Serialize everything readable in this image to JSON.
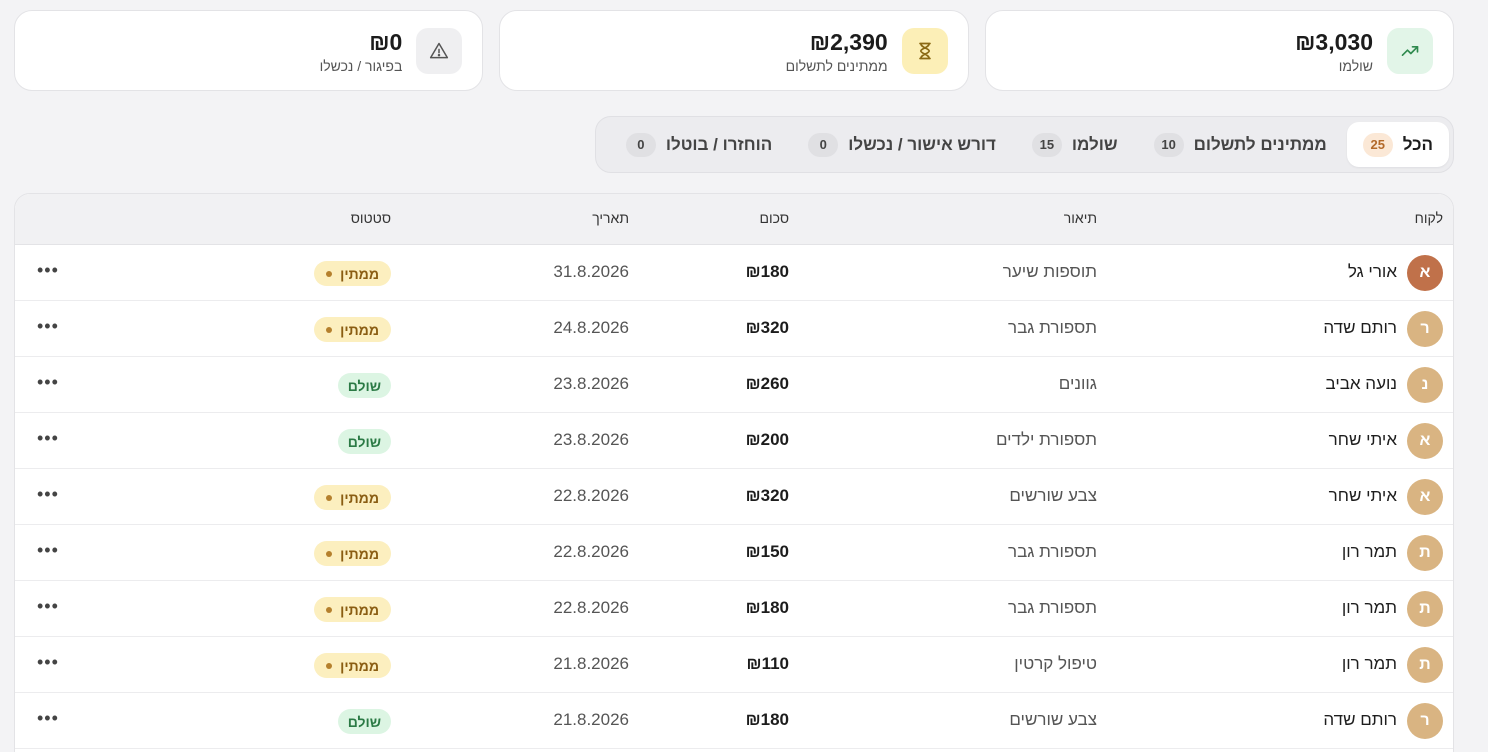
{
  "stats": [
    {
      "amount": "₪3,030",
      "label": "שולמו",
      "icon": "trending-up-icon"
    },
    {
      "amount": "₪2,390",
      "label": "ממתינים לתשלום",
      "icon": "hourglass-icon"
    },
    {
      "amount": "₪0",
      "label": "בפיגור / נכשלו",
      "icon": "warning-icon"
    }
  ],
  "tabs": [
    {
      "label": "הכל",
      "count": "25"
    },
    {
      "label": "ממתינים לתשלום",
      "count": "10"
    },
    {
      "label": "שולמו",
      "count": "15"
    },
    {
      "label": "דורש אישור / נכשלו",
      "count": "0"
    },
    {
      "label": "הוחזרו / בוטלו",
      "count": "0"
    }
  ],
  "table": {
    "headers": {
      "customer": "לקוח",
      "description": "תיאור",
      "amount": "סכום",
      "date": "תאריך",
      "status": "סטטוס"
    },
    "rows": [
      {
        "initial": "א",
        "name": "אורי גל",
        "desc": "תוספות שיער",
        "amount": "₪180",
        "date": "31.8.2026",
        "status": "ממתין"
      },
      {
        "initial": "ר",
        "name": "רותם שדה",
        "desc": "תספורת גבר",
        "amount": "₪320",
        "date": "24.8.2026",
        "status": "ממתין"
      },
      {
        "initial": "נ",
        "name": "נועה אביב",
        "desc": "גוונים",
        "amount": "₪260",
        "date": "23.8.2026",
        "status": "שולם"
      },
      {
        "initial": "א",
        "name": "איתי שחר",
        "desc": "תספורת ילדים",
        "amount": "₪200",
        "date": "23.8.2026",
        "status": "שולם"
      },
      {
        "initial": "א",
        "name": "איתי שחר",
        "desc": "צבע שורשים",
        "amount": "₪320",
        "date": "22.8.2026",
        "status": "ממתין"
      },
      {
        "initial": "ת",
        "name": "תמר רון",
        "desc": "תספורת גבר",
        "amount": "₪150",
        "date": "22.8.2026",
        "status": "ממתין"
      },
      {
        "initial": "ת",
        "name": "תמר רון",
        "desc": "תספורת גבר",
        "amount": "₪180",
        "date": "22.8.2026",
        "status": "ממתין"
      },
      {
        "initial": "ת",
        "name": "תמר רון",
        "desc": "טיפול קרטין",
        "amount": "₪110",
        "date": "21.8.2026",
        "status": "ממתין"
      },
      {
        "initial": "ר",
        "name": "רותם שדה",
        "desc": "צבע שורשים",
        "amount": "₪180",
        "date": "21.8.2026",
        "status": "שולם"
      }
    ]
  }
}
